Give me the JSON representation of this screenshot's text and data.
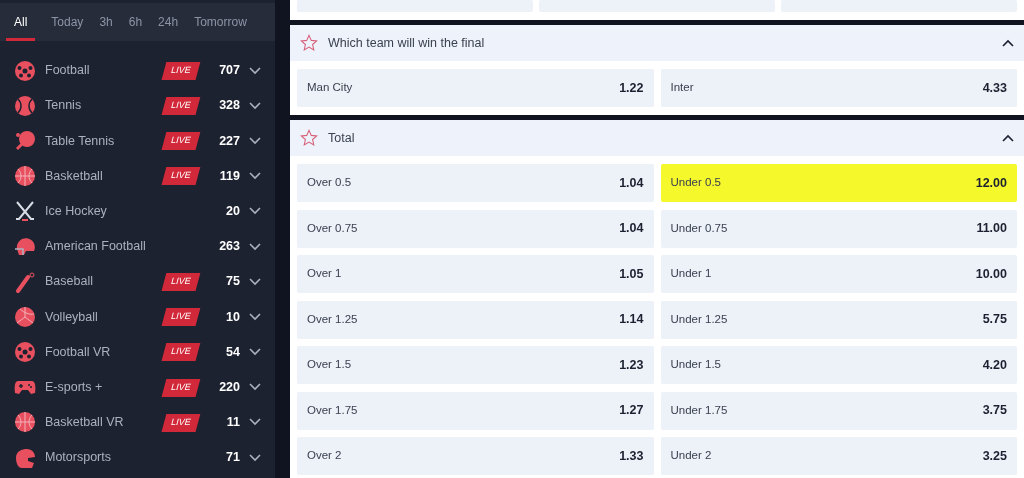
{
  "filter_tabs": [
    {
      "label": "All",
      "selected": true
    },
    {
      "label": "Today",
      "selected": false
    },
    {
      "label": "3h",
      "selected": false
    },
    {
      "label": "6h",
      "selected": false
    },
    {
      "label": "24h",
      "selected": false
    },
    {
      "label": "Tomorrow",
      "selected": false
    }
  ],
  "sports": [
    {
      "name": "Football",
      "live_badge": "LIVE",
      "count": "707"
    },
    {
      "name": "Tennis",
      "live_badge": "LIVE",
      "count": "328"
    },
    {
      "name": "Table Tennis",
      "live_badge": "LIVE",
      "count": "227"
    },
    {
      "name": "Basketball",
      "live_badge": "LIVE",
      "count": "119"
    },
    {
      "name": "Ice Hockey",
      "count": "20"
    },
    {
      "name": "American Football",
      "count": "263"
    },
    {
      "name": "Baseball",
      "live_badge": "LIVE",
      "count": "75"
    },
    {
      "name": "Volleyball",
      "live_badge": "LIVE",
      "count": "10"
    },
    {
      "name": "Football VR",
      "live_badge": "LIVE",
      "count": "54"
    },
    {
      "name": "E-sports +",
      "live_badge": "LIVE",
      "count": "220"
    },
    {
      "name": "Basketball VR",
      "live_badge": "LIVE",
      "count": "11"
    },
    {
      "name": "Motorsports",
      "count": "71"
    }
  ],
  "markets": [
    {
      "title": "Which team will win the final",
      "expanded": true,
      "odds": [
        {
          "label": "Man City",
          "price": "1.22",
          "selected": false
        },
        {
          "label": "Inter",
          "price": "4.33",
          "selected": false
        }
      ]
    },
    {
      "title": "Total",
      "expanded": true,
      "odds": [
        {
          "label": "Over 0.5",
          "price": "1.04",
          "selected": false
        },
        {
          "label": "Under 0.5",
          "price": "12.00",
          "selected": true
        },
        {
          "label": "Over 0.75",
          "price": "1.04",
          "selected": false
        },
        {
          "label": "Under 0.75",
          "price": "11.00",
          "selected": false
        },
        {
          "label": "Over 1",
          "price": "1.05",
          "selected": false
        },
        {
          "label": "Under 1",
          "price": "10.00",
          "selected": false
        },
        {
          "label": "Over 1.25",
          "price": "1.14",
          "selected": false
        },
        {
          "label": "Under 1.25",
          "price": "5.75",
          "selected": false
        },
        {
          "label": "Over 1.5",
          "price": "1.23",
          "selected": false
        },
        {
          "label": "Under 1.5",
          "price": "4.20",
          "selected": false
        },
        {
          "label": "Over 1.75",
          "price": "1.27",
          "selected": false
        },
        {
          "label": "Under 1.75",
          "price": "3.75",
          "selected": false
        },
        {
          "label": "Over 2",
          "price": "1.33",
          "selected": false
        },
        {
          "label": "Under 2",
          "price": "3.25",
          "selected": false
        }
      ]
    }
  ]
}
